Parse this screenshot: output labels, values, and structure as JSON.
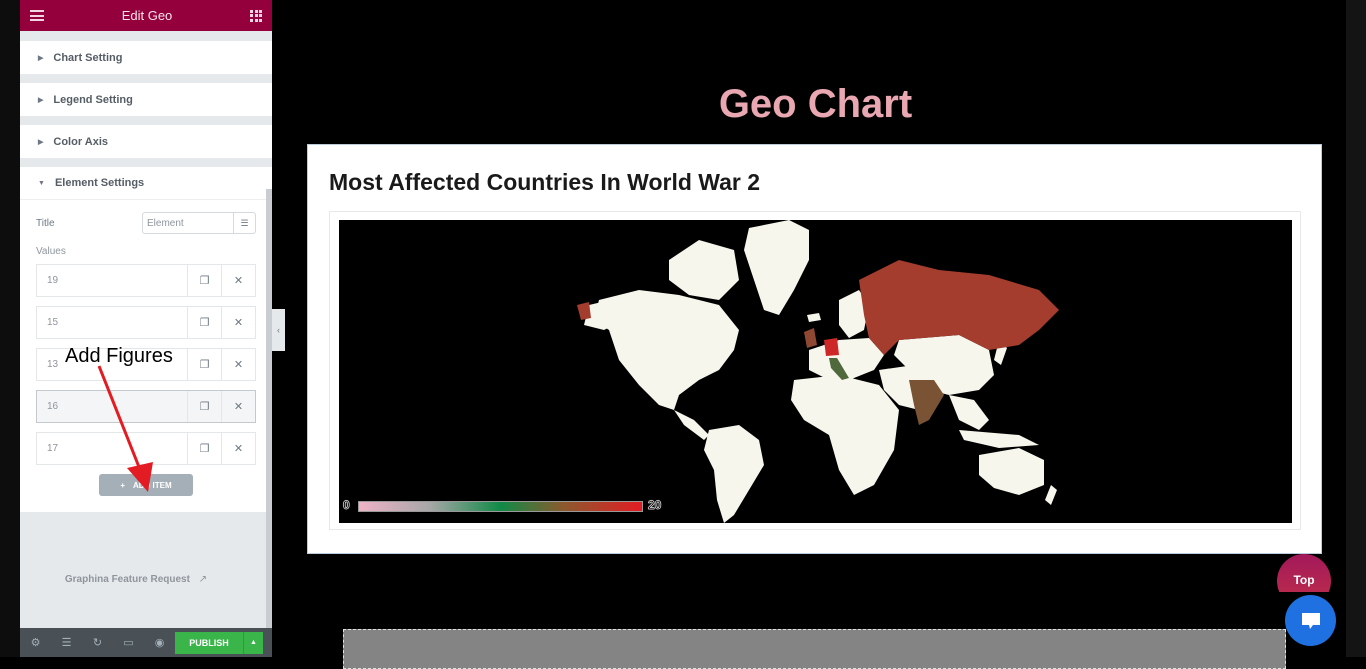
{
  "panel": {
    "header_title": "Edit Geo",
    "sections": [
      {
        "label": "Chart Setting",
        "open": false
      },
      {
        "label": "Legend Setting",
        "open": false
      },
      {
        "label": "Color Axis",
        "open": false
      },
      {
        "label": "Element Settings",
        "open": true
      }
    ],
    "element_settings": {
      "title_label": "Title",
      "title_value": "Element",
      "values_label": "Values",
      "values": [
        "19",
        "15",
        "13",
        "16",
        "17"
      ],
      "add_item_label": "ADD ITEM"
    },
    "feature_request": "Graphina Feature Request",
    "footer": {
      "publish_label": "PUBLISH"
    }
  },
  "annotation": {
    "text": "Add Figures",
    "arrow_color": "#e31c23"
  },
  "page": {
    "heading": "Geo Chart",
    "heading_color": "#e8a7b1",
    "top_button": "Top"
  },
  "chart_data": {
    "type": "geo",
    "title": "Most Affected Countries In World War 2",
    "color_axis": {
      "min": 0,
      "max": 20,
      "min_label": "0",
      "max_label": "20",
      "colors": [
        "#efb3c6",
        "#108a47",
        "#e31c23"
      ]
    },
    "regions": [
      {
        "country": "Germany",
        "value": 19
      },
      {
        "country": "India",
        "value": 15
      },
      {
        "country": "Italy",
        "value": 13
      },
      {
        "country": "United Kingdom",
        "value": 16
      },
      {
        "country": "Russia",
        "value": 17
      }
    ],
    "background": "#000000",
    "default_land_color": "#f7f6ec"
  }
}
